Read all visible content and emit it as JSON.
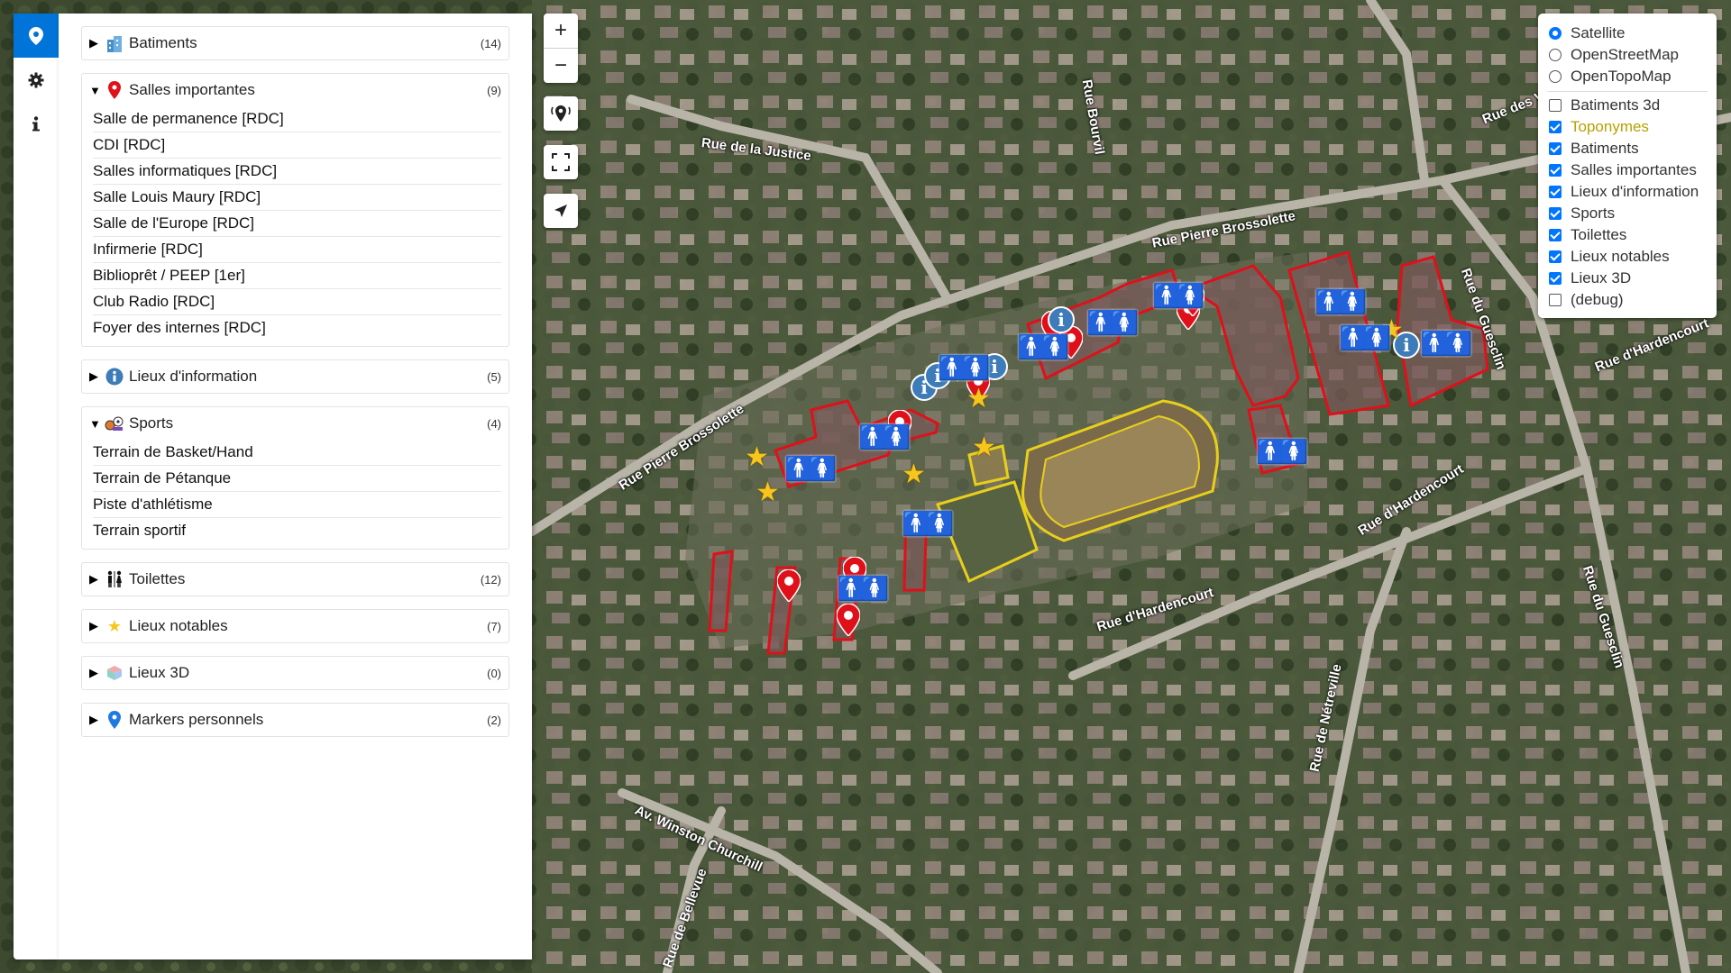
{
  "sidebar": {
    "tabs": [
      {
        "icon": "map-marker-icon",
        "active": true
      },
      {
        "icon": "gear-icon",
        "active": false
      },
      {
        "icon": "info-icon",
        "active": false
      }
    ],
    "categories": [
      {
        "name": "Batiments",
        "count": "(14)",
        "icon": "building-icon",
        "expanded": false,
        "items": []
      },
      {
        "name": "Salles importantes",
        "count": "(9)",
        "icon": "red-pin-icon",
        "expanded": true,
        "items": [
          "Salle de permanence [RDC]",
          "CDI [RDC]",
          "Salles informatiques [RDC]",
          "Salle Louis Maury [RDC]",
          "Salle de l'Europe [RDC]",
          "Infirmerie [RDC]",
          "Biblioprêt / PEEP [1er]",
          "Club Radio [RDC]",
          "Foyer des internes [RDC]"
        ]
      },
      {
        "name": "Lieux d'information",
        "count": "(5)",
        "icon": "info-circle-icon",
        "expanded": false,
        "items": []
      },
      {
        "name": "Sports",
        "count": "(4)",
        "icon": "sports-icon",
        "expanded": true,
        "items": [
          "Terrain de Basket/Hand",
          "Terrain de Pétanque",
          "Piste d'athlétisme",
          "Terrain sportif"
        ]
      },
      {
        "name": "Toilettes",
        "count": "(12)",
        "icon": "toilet-icon",
        "expanded": false,
        "items": []
      },
      {
        "name": "Lieux notables",
        "count": "(7)",
        "icon": "star-icon",
        "expanded": false,
        "items": []
      },
      {
        "name": "Lieux 3D",
        "count": "(0)",
        "icon": "cube-icon",
        "expanded": false,
        "items": []
      },
      {
        "name": "Markers personnels",
        "count": "(2)",
        "icon": "blue-pin-icon",
        "expanded": false,
        "items": []
      }
    ]
  },
  "controls": {
    "zoom_in": "+",
    "zoom_out": "−"
  },
  "layers": {
    "base": [
      {
        "label": "Satellite",
        "selected": true
      },
      {
        "label": "OpenStreetMap",
        "selected": false
      },
      {
        "label": "OpenTopoMap",
        "selected": false
      }
    ],
    "overlays": [
      {
        "label": "Batiments 3d",
        "checked": false
      },
      {
        "label": "Toponymes",
        "checked": true,
        "color": "#b8a200"
      },
      {
        "label": "Batiments",
        "checked": true
      },
      {
        "label": "Salles importantes",
        "checked": true
      },
      {
        "label": "Lieux d'information",
        "checked": true
      },
      {
        "label": "Sports",
        "checked": true
      },
      {
        "label": "Toilettes",
        "checked": true
      },
      {
        "label": "Lieux notables",
        "checked": true
      },
      {
        "label": "Lieux 3D",
        "checked": true
      },
      {
        "label": "(debug)",
        "checked": false
      }
    ]
  },
  "streets": [
    {
      "name": "Rue de la Justice"
    },
    {
      "name": "Rue Bourvil"
    },
    {
      "name": "Rue Pierre Brossolette"
    },
    {
      "name": "Rue Pierre Brossolette"
    },
    {
      "name": "Rue du Guesclin"
    },
    {
      "name": "Rue du Guesclin"
    },
    {
      "name": "Rue d'Hardencourt"
    },
    {
      "name": "Rue d'Hardencourt"
    },
    {
      "name": "Rue d'Hardencourt"
    },
    {
      "name": "Av. Winston Churchill"
    },
    {
      "name": "Rue de Bellevue"
    },
    {
      "name": "Rue de Nétreville"
    },
    {
      "name": "Rue des V"
    }
  ],
  "colors": {
    "accent": "#0074d9",
    "building_outline": "#e0101a",
    "sport_outline": "#e8cf1a",
    "star": "#f7c51c",
    "info": "#3d7cb8"
  }
}
